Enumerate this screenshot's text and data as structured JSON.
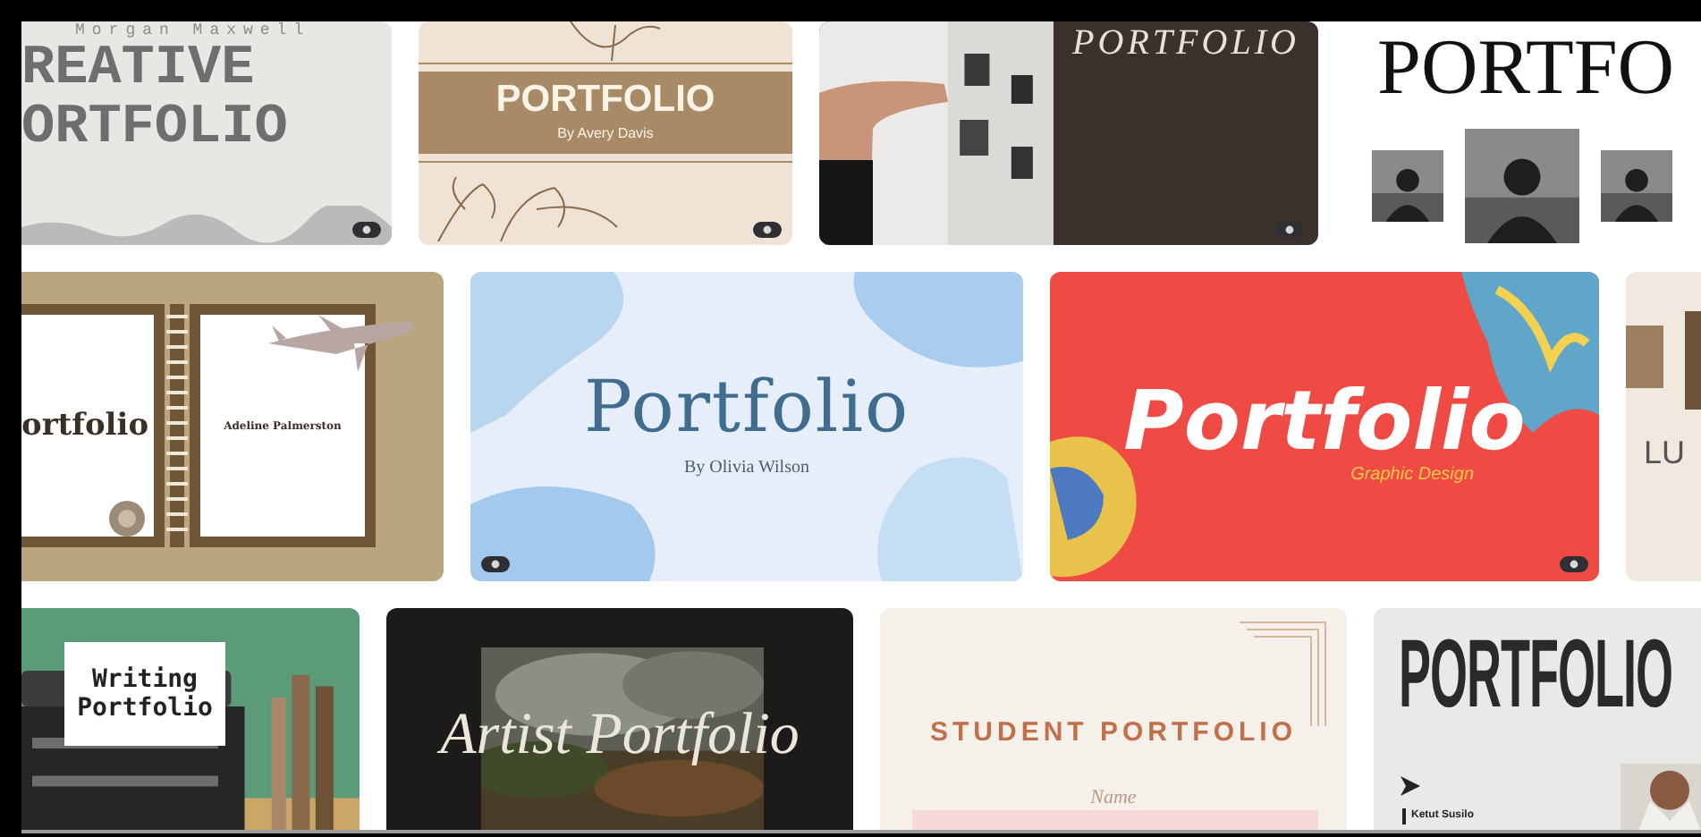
{
  "rows": [
    {
      "cards": [
        {
          "kind": "creative",
          "author": "Morgan Maxwell",
          "title_lines": [
            "REATIVE",
            "ORTFOLIO"
          ],
          "video": true
        },
        {
          "kind": "floral",
          "title": "PORTFOLIO",
          "byline": "By Avery Davis",
          "video": true
        },
        {
          "kind": "photographer",
          "title": "PORTFOLIO",
          "video": true
        },
        {
          "kind": "minimal",
          "title": "PORTFO",
          "video": false
        }
      ]
    },
    {
      "cards": [
        {
          "kind": "notebook",
          "title": "ortfolio",
          "name": "Adeline Palmerston",
          "video": false
        },
        {
          "kind": "watercolor",
          "title": "Portfolio",
          "byline": "By Olivia Wilson",
          "video": true
        },
        {
          "kind": "graphic",
          "title": "Portfolio",
          "subtitle": "Graphic Design",
          "video": true
        },
        {
          "kind": "partial",
          "title": "LU",
          "video": false
        }
      ]
    },
    {
      "cards": [
        {
          "kind": "writing",
          "title_lines": [
            "Writing",
            "Portfolio"
          ],
          "video": false
        },
        {
          "kind": "artist",
          "title": "Artist Portfolio",
          "video": false
        },
        {
          "kind": "student",
          "title": "STUDENT PORTFOLIO",
          "label": "Name",
          "video": false
        },
        {
          "kind": "magazine",
          "title": "PORTFOLIO",
          "name": "Ketut Susilo",
          "video": false
        }
      ]
    }
  ]
}
